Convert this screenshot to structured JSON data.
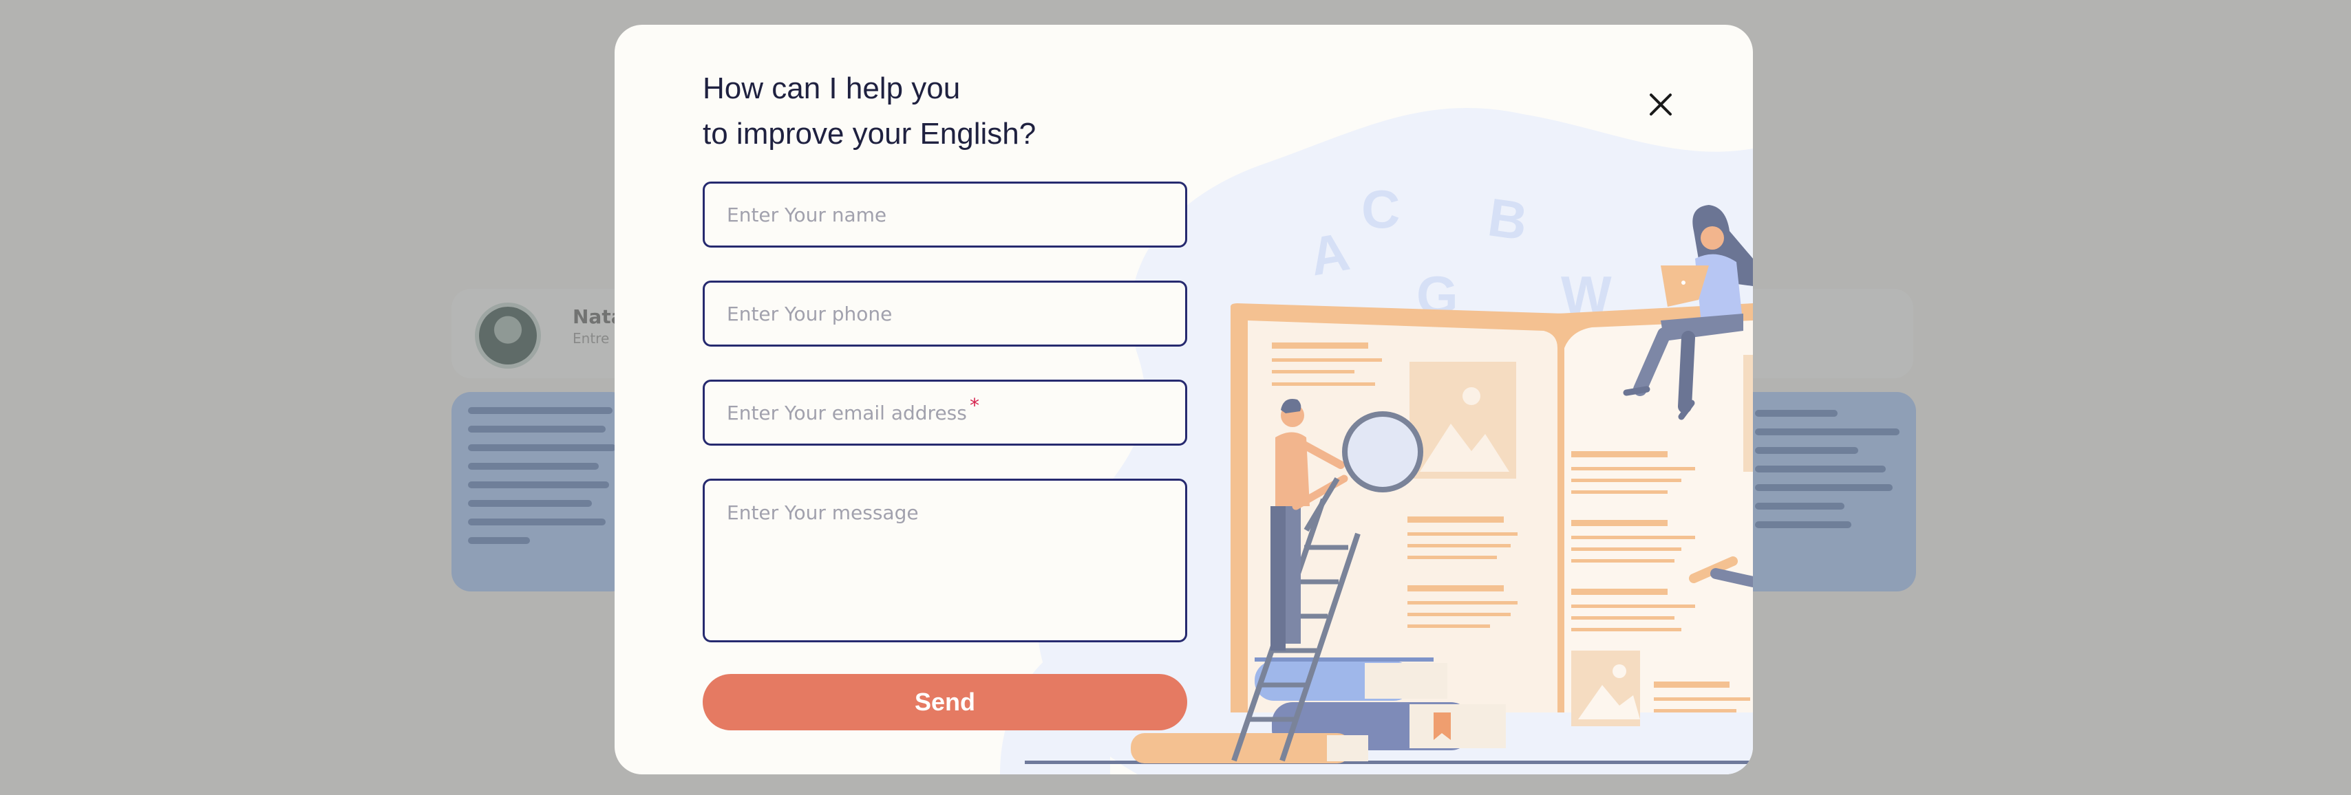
{
  "background": {
    "testimonial_left": {
      "name": "Nata",
      "role": "Entre"
    }
  },
  "modal": {
    "title_line1": "How can I help you",
    "title_line2": "to improve your English?",
    "fields": {
      "name_placeholder": "Enter Your name",
      "phone_placeholder": "Enter Your phone",
      "email_placeholder": "Enter Your email address",
      "email_required_mark": "*",
      "message_placeholder": "Enter Your message"
    },
    "send_label": "Send",
    "illustration_letters": [
      "A",
      "C",
      "G",
      "B",
      "W"
    ]
  },
  "colors": {
    "overlay": "#b3b3b1",
    "modal_bg": "#fdfcf8",
    "field_border": "#262a6f",
    "button": "#e57a62",
    "required": "#d6244f"
  }
}
